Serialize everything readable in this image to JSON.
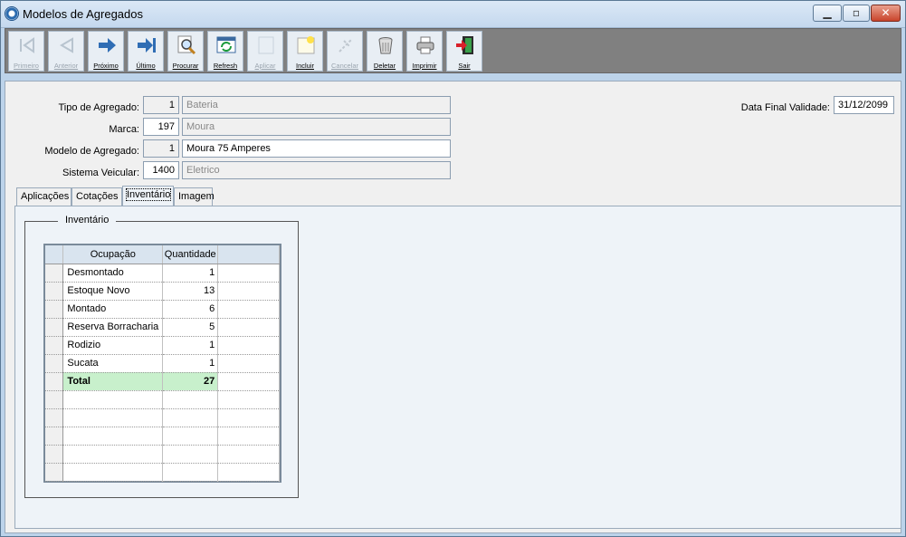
{
  "window": {
    "title": "Modelos de Agregados"
  },
  "toolbar": [
    {
      "label": "Primeiro",
      "enabled": false
    },
    {
      "label": "Anterior",
      "enabled": false
    },
    {
      "label": "Próximo",
      "enabled": true
    },
    {
      "label": "Último",
      "enabled": true
    },
    {
      "label": "Procurar",
      "enabled": true
    },
    {
      "label": "Refresh",
      "enabled": true
    },
    {
      "label": "Aplicar",
      "enabled": false
    },
    {
      "label": "Incluir",
      "enabled": true
    },
    {
      "label": "Cancelar",
      "enabled": false
    },
    {
      "label": "Deletar",
      "enabled": true
    },
    {
      "label": "Imprimir",
      "enabled": true
    },
    {
      "label": "Sair",
      "enabled": true
    }
  ],
  "form": {
    "tipo_label": "Tipo de Agregado:",
    "tipo_code": "1",
    "tipo_desc": "Bateria",
    "marca_label": "Marca:",
    "marca_code": "197",
    "marca_desc": "Moura",
    "modelo_label": "Modelo de Agregado:",
    "modelo_code": "1",
    "modelo_desc": "Moura 75 Amperes",
    "sistema_label": "Sistema Veicular:",
    "sistema_code": "1400",
    "sistema_desc": "Eletrico",
    "validade_label": "Data Final Validade:",
    "validade_value": "31/12/2099"
  },
  "tabs": [
    "Aplicações",
    "Cotações",
    "Inventário",
    "Imagem"
  ],
  "inventory": {
    "group_title": "Inventário",
    "headers": [
      "Ocupação",
      "Quantidade"
    ],
    "rows": [
      {
        "ocupacao": "Desmontado",
        "quantidade": "1"
      },
      {
        "ocupacao": "Estoque Novo",
        "quantidade": "13"
      },
      {
        "ocupacao": "Montado",
        "quantidade": "6"
      },
      {
        "ocupacao": "Reserva Borracharia",
        "quantidade": "5"
      },
      {
        "ocupacao": "Rodizio",
        "quantidade": "1"
      },
      {
        "ocupacao": "Sucata",
        "quantidade": "1"
      }
    ],
    "total_label": "Total",
    "total_value": "27"
  },
  "colors": {
    "total_row": "#c8f0cc",
    "toolbar_bg": "#808080",
    "titlebar": "#c4d8ee"
  }
}
